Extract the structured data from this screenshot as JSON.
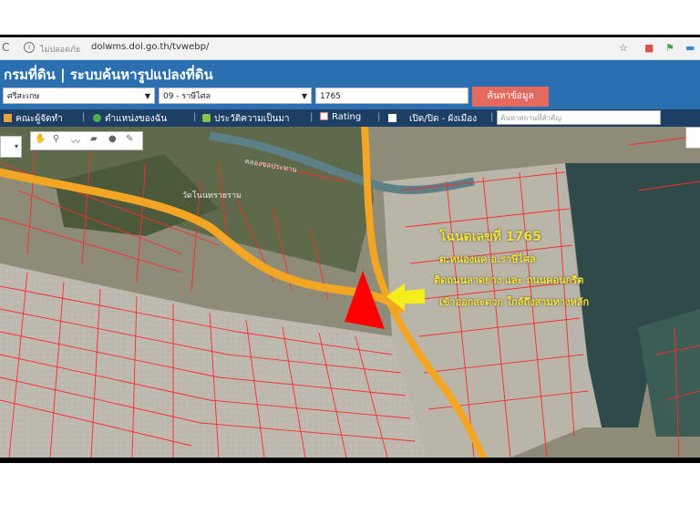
{
  "browser": {
    "security_label": "ไม่ปลอดภัย",
    "url": "dolwms.dol.go.th/tvwebp/",
    "reload_icon": "reload-icon",
    "info_icon": "info-icon",
    "star_icon": "star-icon",
    "extension_icons": [
      "shield-extension-icon",
      "flag-extension-icon",
      "chat-extension-icon"
    ]
  },
  "header": {
    "title": "กรมที่ดิน | ระบบค้นหารูปแปลงที่ดิน"
  },
  "search": {
    "province": "ศรีสะเกษ",
    "district": "09 - ราษีไศล",
    "parcel_number": "1765",
    "search_button": "ค้นหาข้อมูล"
  },
  "toolbar": {
    "items": [
      {
        "label": "คณะผู้จัดทำ",
        "icon": "book-icon"
      },
      {
        "label": "ตำแหน่งของฉัน",
        "icon": "globe-icon"
      },
      {
        "label": "ประวัติความเป็นมา",
        "icon": "plant-icon"
      },
      {
        "label": "Rating",
        "icon": "chart-icon"
      },
      {
        "label": "เปิด/ปิด - ผังเมือง",
        "icon": "square-icon"
      }
    ],
    "place_search_placeholder": "ค้นหาสถานที่สำคัญ"
  },
  "map": {
    "village_label": "วัดโนนทรายราม",
    "road_label": "คลองชลประทาน",
    "annotation": {
      "line1": "โฉนดเลขที่ 1765",
      "line2": "ต.หนองแค อ.ราษีไศล",
      "line3": "ติดถนนลาดยาง และ ถนนคอนกรีต",
      "line4": "เข้าออกสะดวก ใกล้ถึงสามทางหลัก"
    },
    "colors": {
      "parcel_lines": "#ff2a2a",
      "roads": "#f2a623",
      "marker": "#ff0000",
      "arrow": "#f6ee1a",
      "water": "#2f4a48"
    },
    "draw_tools": [
      "hand-icon",
      "pin-icon",
      "polyline-icon",
      "polygon-icon",
      "circle-icon",
      "pen-icon"
    ]
  }
}
